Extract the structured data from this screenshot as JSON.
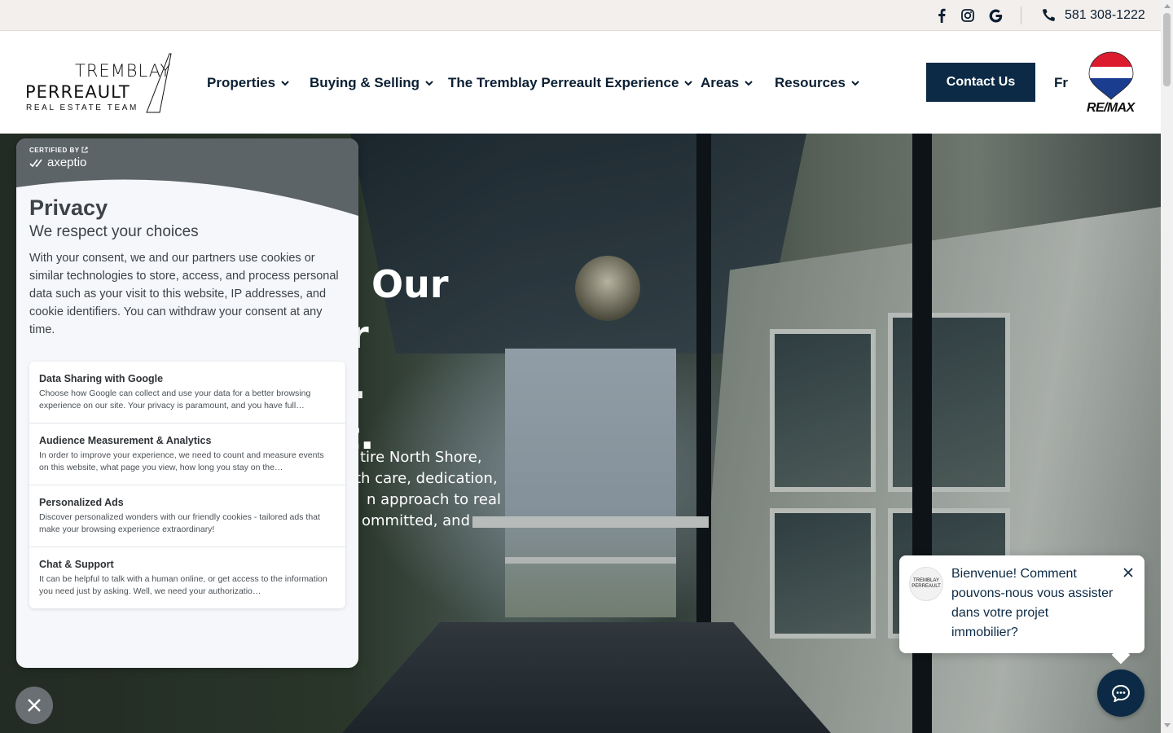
{
  "topbar": {
    "social": [
      {
        "name": "facebook-icon"
      },
      {
        "name": "instagram-icon"
      },
      {
        "name": "google-icon"
      }
    ],
    "phone": "581 308-1222"
  },
  "logo": {
    "line1": "TREMBLAY",
    "line2": "PERREAULT",
    "line3": "REAL ESTATE TEAM"
  },
  "nav": {
    "items": [
      {
        "label": "Properties"
      },
      {
        "label": "Buying & Selling"
      },
      {
        "label": "The Tremblay Perreault Experience"
      },
      {
        "label": "Areas"
      },
      {
        "label": "Resources"
      }
    ],
    "contact_label": "Contact Us",
    "lang_label": "Fr",
    "brand_text": "RE/MAX"
  },
  "hero": {
    "title_fragments": [
      "Our",
      "r",
      ".",
      "t."
    ],
    "text_lines": [
      "tire North Shore,",
      "th care, dedication,",
      "n approach to real",
      "ommitted, and"
    ]
  },
  "privacy": {
    "certified_label": "CERTIFIED BY",
    "brand": "axeptio",
    "title": "Privacy",
    "subtitle": "We respect your choices",
    "description": "With your consent, we and our partners use cookies or similar technologies to store, access, and process personal data such as your visit to this website, IP addresses, and cookie identifiers. You can withdraw your consent at any time.",
    "choices": [
      {
        "title": "Data Sharing with Google",
        "desc": "Choose how Google can collect and use your data for a better browsing experience on our site. Your privacy is paramount, and you have full…"
      },
      {
        "title": "Audience Measurement & Analytics",
        "desc": "In order to improve your experience, we need to count and measure events on this website, what page you view, how long you stay on the…"
      },
      {
        "title": "Personalized Ads",
        "desc": "Discover personalized wonders with our friendly cookies - tailored ads that make your browsing experience extraordinary!"
      },
      {
        "title": "Chat & Support",
        "desc": "It can be helpful to talk with a human online, or get access to the information you need just by asking. Well, we need your authorizatio…"
      }
    ]
  },
  "chat": {
    "message": "Bienvenue! Comment pouvons-nous vous assister dans votre projet immobilier?",
    "avatar_text": "TREMBLAY PERREAULT"
  },
  "colors": {
    "navy": "#0c2a45",
    "topbar_bg": "#f3efec",
    "privacy_banner": "#5c6468"
  }
}
